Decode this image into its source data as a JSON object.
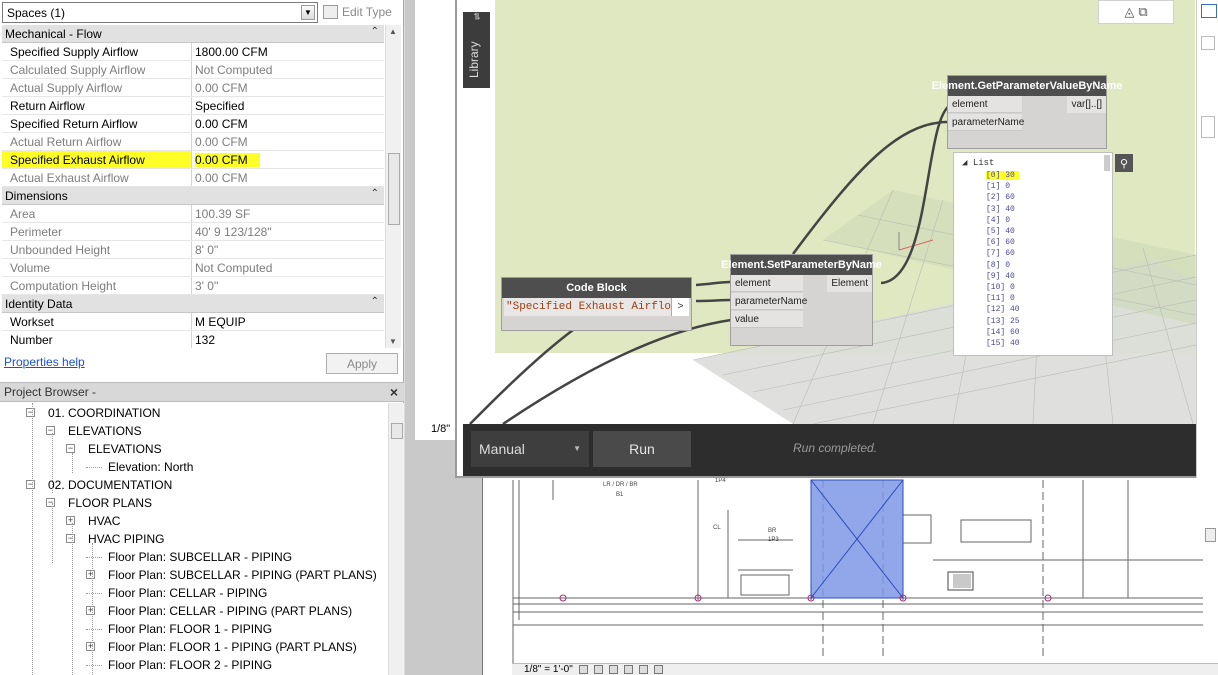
{
  "properties": {
    "type_selector": "Spaces (1)",
    "edit_type_label": "Edit Type",
    "groups": [
      {
        "name": "Mechanical - Flow",
        "rows": [
          {
            "key": "Specified Supply Airflow",
            "value": "1800.00 CFM",
            "readonly": false,
            "highlight": false
          },
          {
            "key": "Calculated Supply Airflow",
            "value": "Not Computed",
            "readonly": true,
            "highlight": false
          },
          {
            "key": "Actual Supply Airflow",
            "value": "0.00 CFM",
            "readonly": true,
            "highlight": false
          },
          {
            "key": "Return Airflow",
            "value": "Specified",
            "readonly": false,
            "highlight": false
          },
          {
            "key": "Specified Return Airflow",
            "value": "0.00 CFM",
            "readonly": false,
            "highlight": false
          },
          {
            "key": "Actual Return Airflow",
            "value": "0.00 CFM",
            "readonly": true,
            "highlight": false
          },
          {
            "key": "Specified Exhaust Airflow",
            "value": "0.00 CFM",
            "readonly": false,
            "highlight": true
          },
          {
            "key": "Actual Exhaust Airflow",
            "value": "0.00 CFM",
            "readonly": true,
            "highlight": false
          }
        ]
      },
      {
        "name": "Dimensions",
        "rows": [
          {
            "key": "Area",
            "value": "100.39 SF",
            "readonly": true,
            "highlight": false
          },
          {
            "key": "Perimeter",
            "value": "40'  9 123/128\"",
            "readonly": true,
            "highlight": false
          },
          {
            "key": "Unbounded Height",
            "value": "8'  0\"",
            "readonly": true,
            "highlight": false
          },
          {
            "key": "Volume",
            "value": "Not Computed",
            "readonly": true,
            "highlight": false
          },
          {
            "key": "Computation Height",
            "value": "3'  0\"",
            "readonly": true,
            "highlight": false
          }
        ]
      },
      {
        "name": "Identity Data",
        "rows": [
          {
            "key": "Workset",
            "value": "M EQUIP",
            "readonly": false,
            "highlight": false
          },
          {
            "key": "Number",
            "value": "132",
            "readonly": false,
            "highlight": false
          }
        ]
      }
    ],
    "help_link": "Properties help",
    "apply_label": "Apply"
  },
  "project_browser": {
    "title": "Project Browser -",
    "close_glyph": "×",
    "items": [
      {
        "label": "01. COORDINATION",
        "level": 1,
        "toggle": "−"
      },
      {
        "label": "ELEVATIONS",
        "level": 2,
        "toggle": "−"
      },
      {
        "label": "ELEVATIONS",
        "level": 3,
        "toggle": "−"
      },
      {
        "label": "Elevation: North",
        "level": 4,
        "toggle": ""
      },
      {
        "label": "02. DOCUMENTATION",
        "level": 1,
        "toggle": "−"
      },
      {
        "label": "FLOOR PLANS",
        "level": 2,
        "toggle": "−"
      },
      {
        "label": "HVAC",
        "level": 3,
        "toggle": "+"
      },
      {
        "label": "HVAC PIPING",
        "level": 3,
        "toggle": "−"
      },
      {
        "label": "Floor Plan: SUBCELLAR - PIPING",
        "level": 4,
        "toggle": ""
      },
      {
        "label": "Floor Plan: SUBCELLAR - PIPING (PART PLANS)",
        "level": 4,
        "toggle": "+"
      },
      {
        "label": "Floor Plan: CELLAR - PIPING",
        "level": 4,
        "toggle": ""
      },
      {
        "label": "Floor Plan: CELLAR - PIPING (PART PLANS)",
        "level": 4,
        "toggle": "+"
      },
      {
        "label": "Floor Plan: FLOOR 1 - PIPING",
        "level": 4,
        "toggle": ""
      },
      {
        "label": "Floor Plan: FLOOR 1 - PIPING (PART PLANS)",
        "level": 4,
        "toggle": "+"
      },
      {
        "label": "Floor Plan: FLOOR 2 - PIPING",
        "level": 4,
        "toggle": ""
      }
    ]
  },
  "view": {
    "scale_label": "1/8\"",
    "plan_scale_label": "1/8\" = 1'-0\"",
    "plan_tags": [
      "LR / DR / BR",
      "B1",
      "1P4",
      "CL",
      "BR",
      "1P3"
    ]
  },
  "dynamo": {
    "library_label": "Library",
    "code_block": {
      "title": "Code Block",
      "code": "\"Specified Exhaust Airflow\";",
      "output_glyph": ">"
    },
    "set_node": {
      "title": "Element.SetParameterByName",
      "inputs": [
        "element",
        "parameterName",
        "value"
      ],
      "output": "Element"
    },
    "get_node": {
      "title": "Element.GetParameterValueByName",
      "inputs": [
        "element",
        "parameterName"
      ],
      "output": "var[]..[]"
    },
    "watch": {
      "header": "List",
      "items": [
        "[0] 30",
        "[1] 0",
        "[2] 60",
        "[3] 40",
        "[4] 0",
        "[5] 40",
        "[6] 60",
        "[7] 60",
        "[8] 0",
        "[9] 40",
        "[10] 0",
        "[11] 0",
        "[12] 40",
        "[13] 25",
        "[14] 60",
        "[15] 40"
      ]
    },
    "run_mode": "Manual",
    "run_label": "Run",
    "status": "Run completed."
  }
}
